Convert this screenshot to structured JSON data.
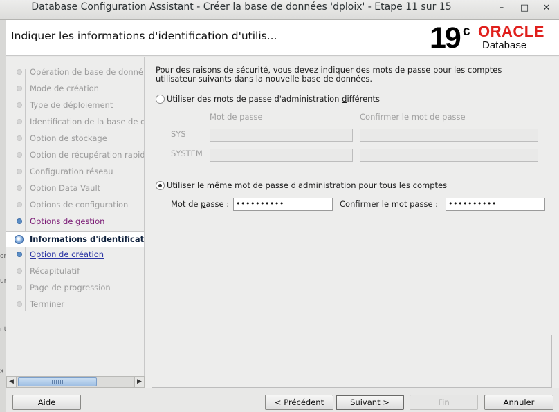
{
  "window": {
    "title": "Database Configuration Assistant - Créer la base de données 'dploix' - Etape 11 sur 15",
    "minimize_glyph": "–",
    "maximize_glyph": "□",
    "close_glyph": "✕"
  },
  "header": {
    "page_title": "Indiquer les informations d'identification d'utilis...",
    "logo_version": "19",
    "logo_sup": "c",
    "logo_brand": "ORACLE",
    "logo_product": "Database"
  },
  "left_edge": [
    "on",
    "ur",
    "nt",
    "x"
  ],
  "steps": [
    {
      "label": "Opération de base de donné",
      "state": "disabled"
    },
    {
      "label": "Mode de création",
      "state": "disabled"
    },
    {
      "label": "Type de déploiement",
      "state": "disabled"
    },
    {
      "label": "Identification de la base de d",
      "state": "disabled"
    },
    {
      "label": "Option de stockage",
      "state": "disabled"
    },
    {
      "label": "Option de récupération rapid",
      "state": "disabled"
    },
    {
      "label": "Configuration réseau",
      "state": "disabled"
    },
    {
      "label": "Option Data Vault",
      "state": "disabled"
    },
    {
      "label": "Options de configuration",
      "state": "disabled"
    },
    {
      "label": "Options de gestion",
      "state": "visited"
    },
    {
      "label": "Informations d'identificati",
      "state": "current"
    },
    {
      "label": "Option de création",
      "state": "link"
    },
    {
      "label": "Récapitulatif",
      "state": "disabled"
    },
    {
      "label": "Page de progression",
      "state": "disabled"
    },
    {
      "label": "Terminer",
      "state": "disabled"
    }
  ],
  "main": {
    "intro": "Pour des raisons de sécurité, vous devez indiquer des mots de passe pour les comptes utilisateur suivants dans la nouvelle base de données.",
    "option_different": {
      "label_pre": "Utiliser des mots de passe d'administration ",
      "label_mnemonic": "d",
      "label_post": "ifférents",
      "selected": false
    },
    "col_password": "Mot de passe",
    "col_confirm": "Confirmer le mot de passe",
    "row_sys": "SYS",
    "row_system": "SYSTEM",
    "option_same": {
      "label_mnemonic": "U",
      "label_post": "tiliser le même mot de passe d'administration pour tous les comptes",
      "selected": true
    },
    "password_label_pre": "Mot de ",
    "password_label_mnemonic": "p",
    "password_label_post": "asse :",
    "password_value": "••••••••••",
    "confirm_label": "Confirmer le mot passe :",
    "confirm_value": "••••••••••"
  },
  "buttons": {
    "help_pre": "",
    "help_mnemonic": "A",
    "help_post": "ide",
    "prev_pre": "< ",
    "prev_mnemonic": "P",
    "prev_post": "récédent",
    "next_pre": "",
    "next_mnemonic": "S",
    "next_post": "uivant >",
    "finish_mnemonic": "F",
    "finish_post": "in",
    "cancel": "Annuler"
  },
  "colors": {
    "oracle_red": "#e0201d",
    "link_blue": "#2a34a4",
    "visited_purple": "#7b1c76"
  }
}
